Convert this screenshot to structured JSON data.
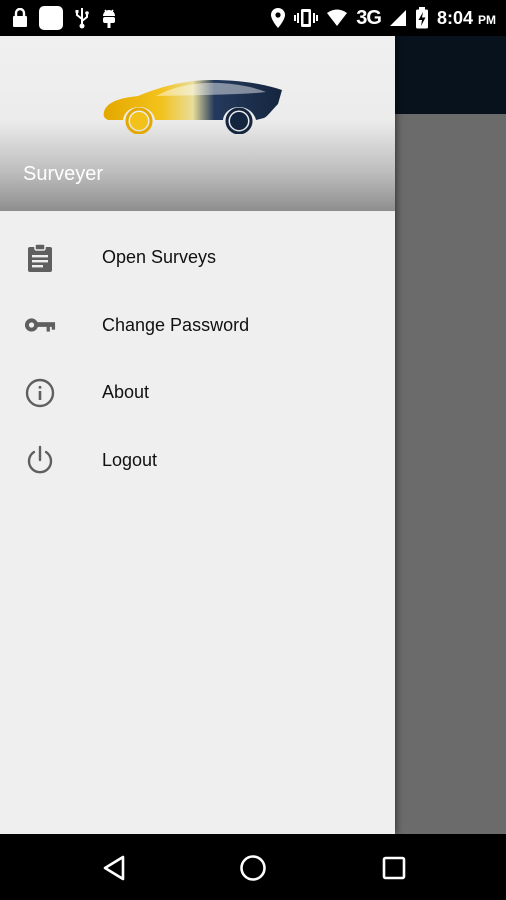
{
  "status_bar": {
    "network_label": "3G",
    "time": "8:04",
    "ampm": "PM"
  },
  "drawer": {
    "app_name": "Surveyer",
    "items": [
      {
        "label": "Open Surveys",
        "icon": "clipboard-icon"
      },
      {
        "label": "Change Password",
        "icon": "key-icon"
      },
      {
        "label": "About",
        "icon": "info-icon"
      },
      {
        "label": "Logout",
        "icon": "power-icon"
      }
    ]
  },
  "nav_bar": {
    "buttons": [
      "back-icon",
      "home-icon",
      "recents-icon"
    ]
  },
  "colors": {
    "drawer_bg": "#efefef",
    "scrim": "#6b6b6b",
    "toolbar": "#07121c",
    "logo_yellow": "#f0b400",
    "logo_navy": "#14253f"
  }
}
